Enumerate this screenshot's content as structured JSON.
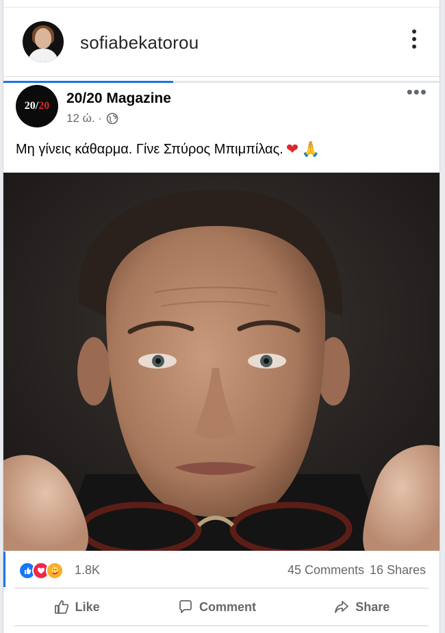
{
  "ig_header": {
    "username": "sofiabekatorou"
  },
  "progress": {
    "fraction": 0.39,
    "color": "#1b74e4"
  },
  "post": {
    "page_name": "20/20 Magazine",
    "logo_text_main": "20/",
    "logo_text_accent": "20",
    "time": "12 ώ. ·",
    "privacy_icon": "globe-icon",
    "text": "Μη γίνεις κάθαρμα. Γίνε Σπύρος Μπιμπίλας.",
    "emojis": [
      "❤",
      "🙏"
    ],
    "options_glyph": "•••"
  },
  "reactions": {
    "icons": [
      "like-reaction-icon",
      "love-reaction-icon",
      "care-reaction-icon"
    ],
    "count": "1.8K",
    "comments": "45 Comments",
    "shares": "16 Shares"
  },
  "actions": {
    "like": "Like",
    "comment": "Comment",
    "share": "Share"
  },
  "colors": {
    "accent": "#1b74e4",
    "like_blue": "#1877f2",
    "love_red": "#f0284a",
    "care_yellow": "#f7b125",
    "brand_red": "#e0262b"
  }
}
